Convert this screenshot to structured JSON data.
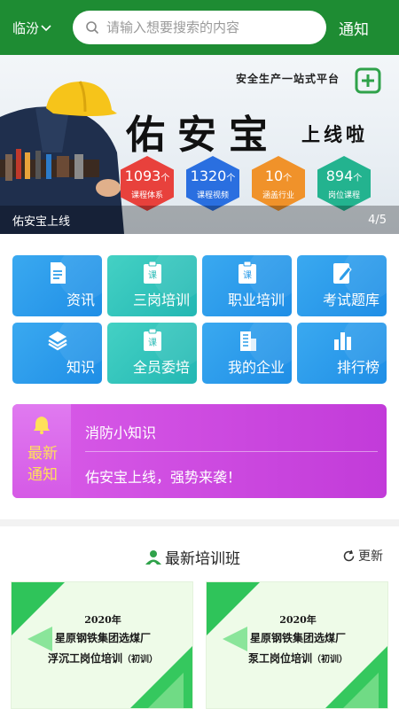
{
  "header": {
    "city": "临汾",
    "search_placeholder": "请输入想要搜索的内容",
    "notice": "通知",
    "bg_color": "#1e8c33"
  },
  "banner": {
    "platform_tag": "安全生产一站式平台",
    "brand": "佑安宝",
    "brand_sub": "上线啦",
    "stats": [
      {
        "num": "1093",
        "unit": "个",
        "label": "课程体系",
        "color": "#e8413c"
      },
      {
        "num": "1320",
        "unit": "个",
        "label": "课程视频",
        "color": "#2a6fe0"
      },
      {
        "num": "10",
        "unit": "个",
        "label": "涵盖行业",
        "color": "#f0922a"
      },
      {
        "num": "894",
        "unit": "个",
        "label": "岗位课程",
        "color": "#23b38f"
      }
    ],
    "caption": "佑安宝上线",
    "page_indicator": "4/5"
  },
  "grid": [
    {
      "label": "资讯",
      "icon": "document-icon",
      "style": "blue"
    },
    {
      "label": "三岗培训",
      "icon": "course-clipboard-icon",
      "style": "teal"
    },
    {
      "label": "职业培训",
      "icon": "course-clipboard-icon",
      "style": "blue"
    },
    {
      "label": "考试题库",
      "icon": "exam-pencil-icon",
      "style": "blue"
    },
    {
      "label": "知识",
      "icon": "layers-icon",
      "style": "blue"
    },
    {
      "label": "全员委培",
      "icon": "course-clipboard-icon",
      "style": "teal"
    },
    {
      "label": "我的企业",
      "icon": "building-icon",
      "style": "blue"
    },
    {
      "label": "排行榜",
      "icon": "bar-chart-icon",
      "style": "blue"
    }
  ],
  "latest_notice": {
    "title_line1": "最新",
    "title_line2": "通知",
    "items": [
      "消防小知识",
      "佑安宝上线，强势来袭！"
    ]
  },
  "training": {
    "title": "最新培训班",
    "refresh": "更新",
    "courses": [
      {
        "year": "2020年",
        "line1": "星原钢铁集团选煤厂",
        "line2": "浮沉工岗位培训",
        "tag": "（初训）"
      },
      {
        "year": "2020年",
        "line1": "星原钢铁集团选煤厂",
        "line2": "泵工岗位培训",
        "tag": "（初训）"
      }
    ]
  }
}
